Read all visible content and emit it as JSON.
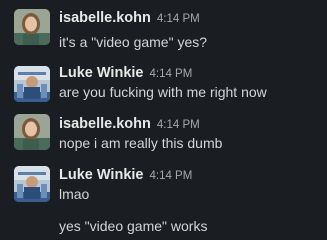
{
  "messages": [
    {
      "author": "isabelle.kohn",
      "time": "4:14 PM",
      "lines": [
        "it's a \"video game\" yes?"
      ],
      "avatar": "isabelle-avatar"
    },
    {
      "author": "Luke Winkie",
      "time": "4:14 PM",
      "lines": [
        "are you fucking with me right now"
      ],
      "avatar": "luke-avatar"
    },
    {
      "author": "isabelle.kohn",
      "time": "4:14 PM",
      "lines": [
        "nope i am really this dumb"
      ],
      "avatar": "isabelle-avatar"
    },
    {
      "author": "Luke Winkie",
      "time": "4:14 PM",
      "lines": [
        "lmao",
        "yes \"video game\" works"
      ],
      "avatar": "luke-avatar"
    }
  ],
  "colors": {
    "background": "#1a1d21",
    "author": "#e8e8e8",
    "timestamp": "#a8a9ab",
    "text": "#d4d5d6"
  }
}
